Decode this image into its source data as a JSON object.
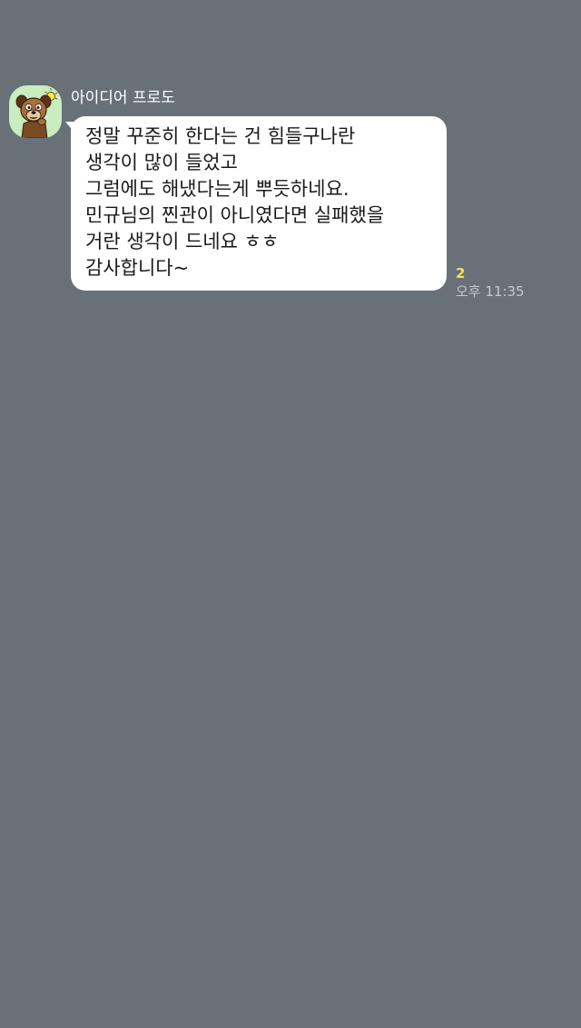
{
  "chat": {
    "message": {
      "sender": "아이디어 프로도",
      "avatar_icon": "frodo-dog-character-icon",
      "lines": [
        "정말 꾸준히 한다는 건 힘들구나란",
        "생각이 많이 들었고",
        "그럼에도 해냈다는게 뿌듯하네요.",
        "민규님의 찐관이 아니였다면 실패했을",
        "거란 생각이 드네요 ㅎㅎ",
        "감사합니다~"
      ],
      "unread_count": "2",
      "timestamp": "오후 11:35"
    }
  },
  "colors": {
    "background": "#687078",
    "bubble": "#ffffff",
    "unread": "#f6e05e",
    "avatar_bg": "#c9ecc0"
  }
}
